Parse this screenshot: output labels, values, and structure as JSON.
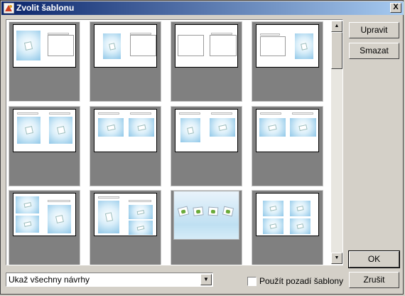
{
  "window": {
    "title": "Zvolit šablonu",
    "close_label": "X"
  },
  "buttons": {
    "edit": "Upravit",
    "delete": "Smazat",
    "ok": "OK",
    "cancel": "Zrušit"
  },
  "filter": {
    "selected": "Ukaž všechny návrhy"
  },
  "background_option": {
    "label": "Použít pozadí šablony",
    "checked": false
  },
  "templates": [
    {
      "layout": "pic-left-frame-right"
    },
    {
      "layout": "pic-left-frame-right-b"
    },
    {
      "layout": "frame-left-frame-right"
    },
    {
      "layout": "frame-left-pic-right"
    },
    {
      "layout": "two-pics-headers"
    },
    {
      "layout": "two-pics-headers-b"
    },
    {
      "layout": "two-pics-headers-c"
    },
    {
      "layout": "two-pics-headers-d"
    },
    {
      "layout": "pic-left-stack-right"
    },
    {
      "layout": "stack-left-stack-right"
    },
    {
      "layout": "full-bleed-cards"
    },
    {
      "layout": "four-pics"
    }
  ],
  "colors": {
    "title_start": "#0a246a",
    "title_end": "#a6caf0",
    "tile_bg": "#808080",
    "dialog_bg": "#d4d0c8"
  }
}
